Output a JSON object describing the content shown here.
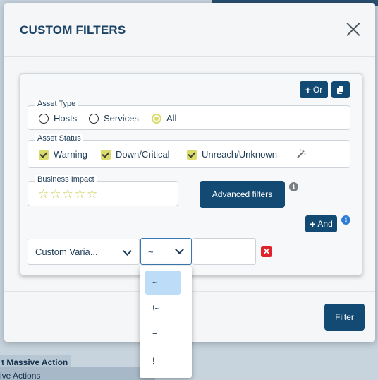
{
  "modal": {
    "title": "CUSTOM FILTERS",
    "filter_button": "Filter"
  },
  "panel": {
    "or_button": "Or",
    "and_button": "And",
    "asset_type": {
      "legend": "Asset Type",
      "options": [
        "Hosts",
        "Services",
        "All"
      ],
      "selected": "All"
    },
    "asset_status": {
      "legend": "Asset Status",
      "options": [
        "Warning",
        "Down/Critical",
        "Unreach/Unknown"
      ]
    },
    "business_impact": {
      "legend": "Business Impact",
      "stars": [
        "☆",
        "☆",
        "☆",
        "☆",
        "☆"
      ]
    },
    "advanced_filters_button": "Advanced filters",
    "condition": {
      "field": "Custom Varia...",
      "operator": "~",
      "value": ""
    }
  },
  "operator_dropdown": {
    "options": [
      "~",
      "!~",
      "=",
      "!="
    ],
    "selected": "~"
  },
  "background": {
    "massive_action": "t Massive Action",
    "actions": "ive Actions"
  },
  "colors": {
    "primary": "#124a73",
    "check": "#d9dc6b",
    "danger": "#e0232a",
    "info": "#2e7bd6"
  }
}
